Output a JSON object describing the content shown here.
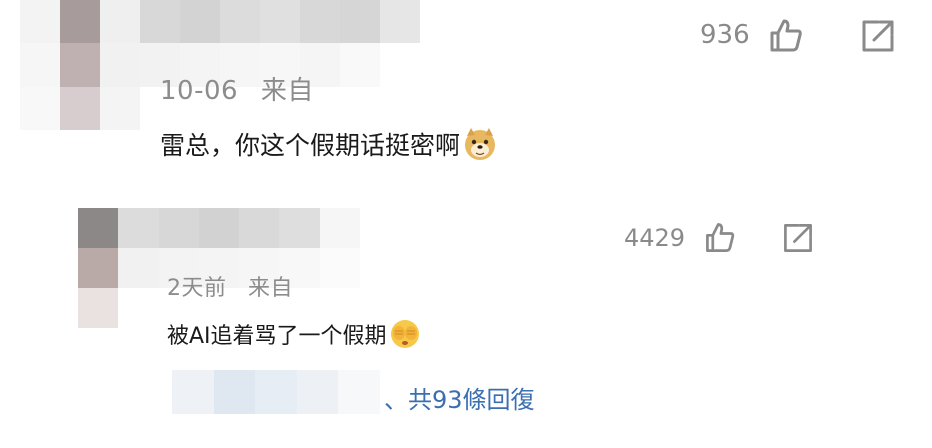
{
  "comments": [
    {
      "date": "10-06",
      "source": "来自",
      "text": "雷总，你这个假期话挺密啊",
      "emoji": "doge-emoji",
      "like_count": "936",
      "like_icon": "thumbs-up-icon",
      "share_icon": "share-icon"
    },
    {
      "date": "2天前",
      "source": "来自",
      "text": "被AI追着骂了一个假期",
      "emoji": "cover-face-emoji",
      "like_count": "4429",
      "like_icon": "thumbs-up-icon",
      "share_icon": "share-icon",
      "replies_text": "、共93條回復"
    }
  ],
  "colors": {
    "link": "#3a6fb0",
    "meta": "#8c8c8c"
  }
}
